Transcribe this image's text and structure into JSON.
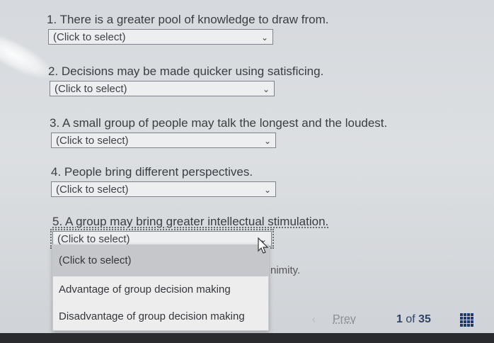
{
  "questions": [
    {
      "label": "1. There is a greater pool of knowledge to draw from.",
      "value": "(Click to select)"
    },
    {
      "label": "2. Decisions may be made quicker using satisficing.",
      "value": "(Click to select)"
    },
    {
      "label": "3. A small group of people may talk the longest and the loudest.",
      "value": "(Click to select)"
    },
    {
      "label": "4. People bring different perspectives.",
      "value": "(Click to select)"
    },
    {
      "label": "5. A group may bring greater intellectual stimulation.",
      "value": "(Click to select)"
    }
  ],
  "dropdown": {
    "options": [
      "(Click to select)",
      "Advantage of group decision making",
      "Disadvantage of group decision making"
    ],
    "selected_index": 0
  },
  "hidden_text": "nimity.",
  "footer": {
    "prev_label": "Prev",
    "page_current": "1",
    "page_of": "of",
    "page_total": "35"
  },
  "icons": {
    "chevron": "chevron-down-icon",
    "prev": "chevron-left-icon",
    "grid": "grid-icon",
    "cursor": "cursor-icon"
  }
}
